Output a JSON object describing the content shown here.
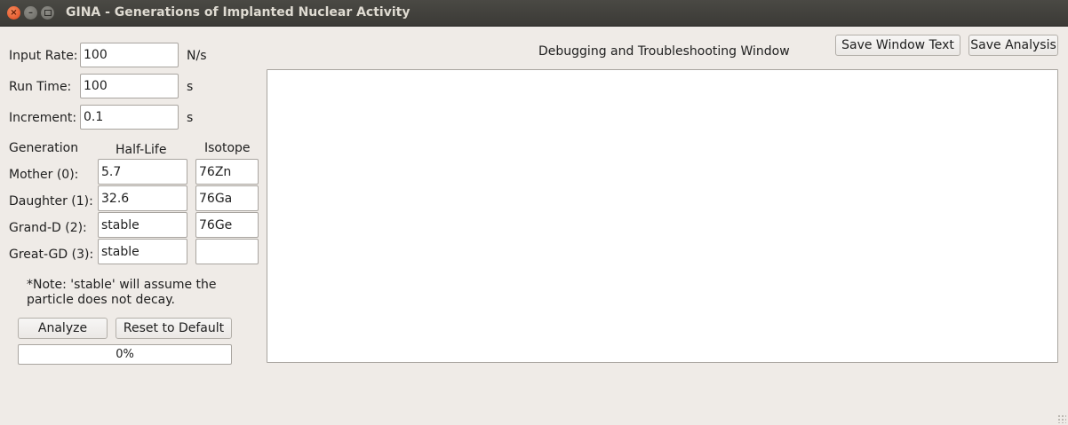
{
  "window": {
    "title": "GINA - Generations of Implanted Nuclear Activity"
  },
  "inputs": {
    "input_rate": {
      "label": "Input Rate:",
      "value": "100",
      "unit": "N/s"
    },
    "run_time": {
      "label": "Run Time:",
      "value": "100",
      "unit": "s"
    },
    "increment": {
      "label": "Increment:",
      "value": "0.1",
      "unit": "s"
    }
  },
  "table": {
    "headers": {
      "generation": "Generation",
      "half_life": "Half-Life",
      "isotope": "Isotope"
    },
    "rows": [
      {
        "label": "Mother (0):",
        "half_life": "5.7",
        "isotope": "76Zn"
      },
      {
        "label": "Daughter (1):",
        "half_life": "32.6",
        "isotope": "76Ga"
      },
      {
        "label": "Grand-D (2):",
        "half_life": "stable",
        "isotope": "76Ge"
      },
      {
        "label": "Great-GD (3):",
        "half_life": "stable",
        "isotope": ""
      }
    ]
  },
  "note": {
    "line1": "*Note: 'stable' will assume the",
    "line2": "particle does not decay."
  },
  "buttons": {
    "analyze": "Analyze",
    "reset": "Reset to Default",
    "save_window_text": "Save Window Text",
    "save_analysis": "Save Analysis"
  },
  "progress": {
    "text": "0%",
    "value": 0
  },
  "debug": {
    "title": "Debugging and Troubleshooting Window",
    "content": ""
  },
  "colors": {
    "background": "#efebe7",
    "titlebar": "#3d3c38",
    "close_button": "#e95420",
    "progress_fill": "#f07746"
  }
}
